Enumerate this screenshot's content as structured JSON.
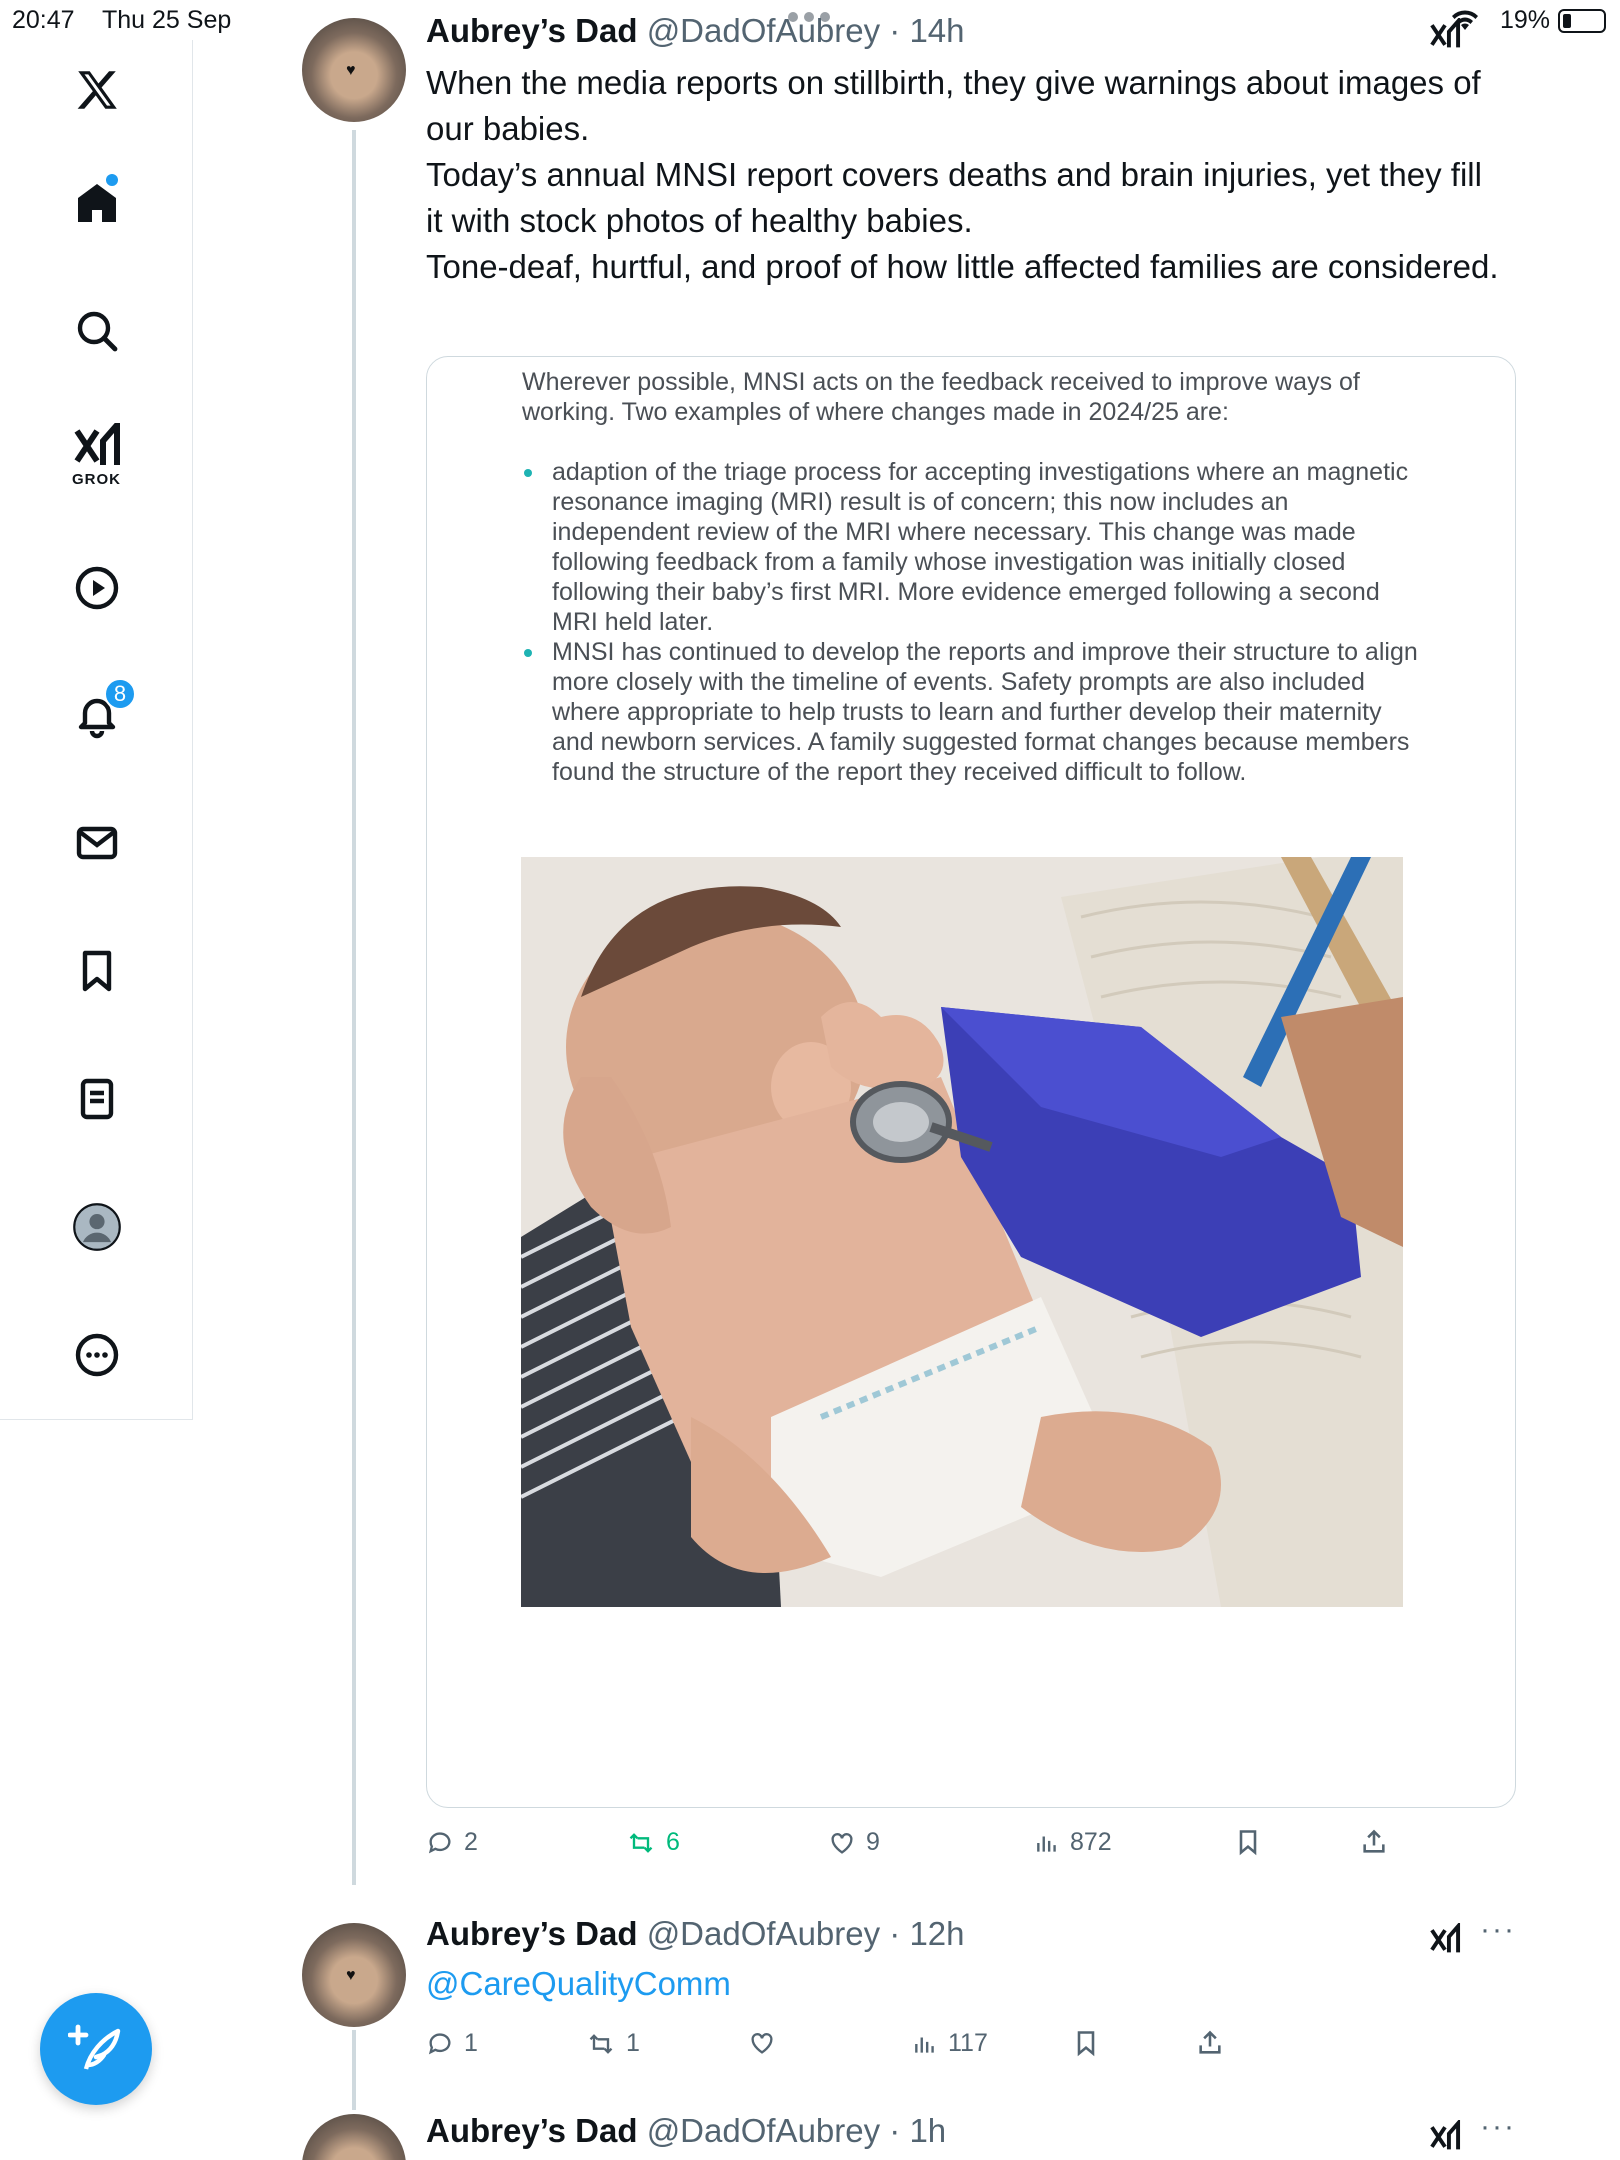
{
  "status_bar": {
    "time": "20:47",
    "date": "Thu 25 Sep",
    "battery": "19%"
  },
  "sidebar": {
    "grok_label": "GROK",
    "notifications_count": "8"
  },
  "tweets": [
    {
      "name": "Aubrey’s Dad",
      "handle": "@DadOfAubrey",
      "time": "· 14h",
      "text": [
        "When the media reports on stillbirth, they give warnings about images of our babies.",
        "Today’s annual MNSI report covers deaths and brain injuries, yet they fill it with stock photos of healthy babies.",
        "Tone-deaf, hurtful, and proof of how little affected families are considered."
      ],
      "document": {
        "intro": "Wherever possible, MNSI acts on the feedback received to improve ways of working. Two examples of where changes made in 2024/25 are:",
        "bullets": [
          "adaption of the triage process for accepting investigations where an magnetic resonance imaging (MRI) result is of concern; this now includes an independent review of the MRI where necessary. This change was made following feedback from a family whose investigation was initially closed following their baby’s first MRI. More evidence emerged following a second MRI held later.",
          "MNSI has continued to develop the reports and improve their structure to align more closely with the timeline of events. Safety prompts are also included where appropriate to help trusts to learn and further develop their maternity and newborn services. A family suggested format changes because members found the structure of the report they received difficult to follow."
        ]
      },
      "stats": {
        "replies": "2",
        "reposts": "6",
        "likes": "9",
        "views": "872"
      }
    },
    {
      "name": "Aubrey’s Dad",
      "handle": "@DadOfAubrey",
      "time": "· 12h",
      "mention": "@CareQualityComm",
      "stats": {
        "replies": "1",
        "reposts": "1",
        "likes": "",
        "views": "117"
      }
    },
    {
      "name": "Aubrey’s Dad",
      "handle": "@DadOfAubrey",
      "time": "· 1h"
    }
  ],
  "colors": {
    "accent": "#1d9bf0",
    "repost_green": "#00ba7c",
    "muted": "#536471"
  }
}
